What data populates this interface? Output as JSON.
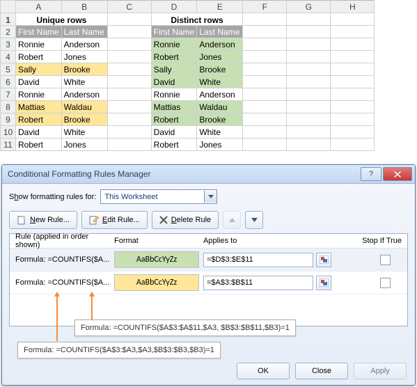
{
  "cols": [
    "A",
    "B",
    "C",
    "D",
    "E",
    "F",
    "G",
    "H"
  ],
  "headers": {
    "unique": "Unique rows",
    "distinct": "Distinct rows",
    "first": "First Name",
    "last": "Last Name"
  },
  "table": {
    "first": [
      "Ronnie",
      "Robert",
      "Sally",
      "David",
      "Ronnie",
      "Mattias",
      "Robert",
      "David",
      "Robert"
    ],
    "last": [
      "Anderson",
      "Jones",
      "Brooke",
      "White",
      "Anderson",
      "Waldau",
      "Brooke",
      "White",
      "Jones"
    ]
  },
  "hl_unique": [
    2,
    5,
    6
  ],
  "hl_distinct": [
    0,
    1,
    2,
    3,
    5,
    6
  ],
  "dialog": {
    "title": "Conditional Formatting Rules Manager",
    "show_label_pre": "S",
    "show_label_u": "h",
    "show_label_post": "ow formatting rules for:",
    "scope": "This Worksheet",
    "buttons": {
      "new_u": "N",
      "new": "ew Rule...",
      "edit_u": "E",
      "edit": "dit Rule...",
      "del_u": "D",
      "del": "elete Rule"
    },
    "head": {
      "rule": "Rule (applied in order shown)",
      "format": "Format",
      "applies": "Applies to",
      "stop": "Stop If True"
    },
    "rules": [
      {
        "short": "=COUNTIFS($A...",
        "sample": "AaBbCcYyZz",
        "applies": "=$D$3:$E$11",
        "bg": "#c6e0b4"
      },
      {
        "short": "=COUNTIFS($A...",
        "sample": "AaBbCcYyZz",
        "applies": "=$A$3:$B$11",
        "bg": "#ffe699"
      }
    ],
    "rule_prefix": "Formula: ",
    "footer": {
      "ok": "OK",
      "close": "Close",
      "apply": "Apply"
    },
    "tooltip1": "Formula: =COUNTIFS($A$3:$A$11,$A3, $B$3:$B$11,$B3)=1",
    "tooltip2": "Formula: =COUNTIFS($A$3:$A3,$A3,$B$3:$B3,$B3)=1"
  }
}
